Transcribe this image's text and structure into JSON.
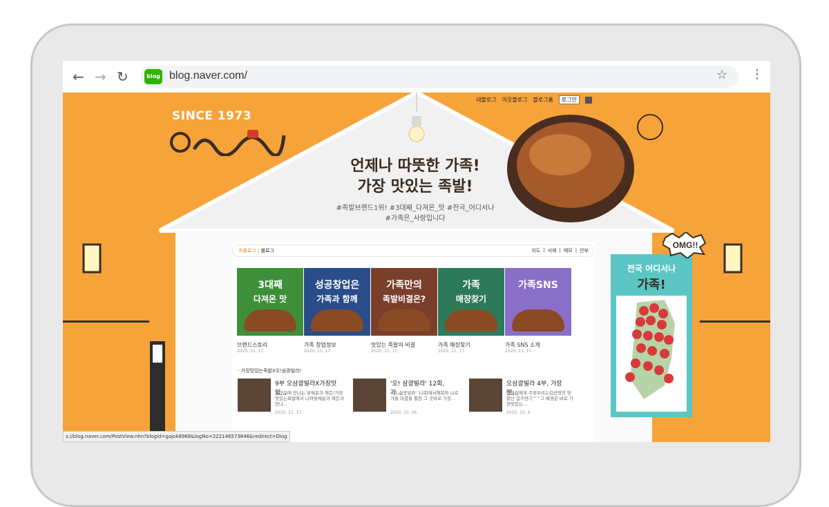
{
  "browser": {
    "url": "blog.naver.com/",
    "blog_icon_label": "blog",
    "back": "←",
    "forward": "→",
    "reload": "↻",
    "star": "☆",
    "menu": "⋮"
  },
  "topmenu": {
    "item1": "내블로그",
    "item2": "이웃블로그",
    "item3": "블로그홈",
    "login": "로그인"
  },
  "hero": {
    "since": "SINCE 1973",
    "headline1": "언제나 따뜻한 가족!",
    "headline2": "가장 맛있는 족발!",
    "tags1": "#족발브랜드1위! #3대째_다져온_맛 #전국_어디서나",
    "tags2": "#가족은_사랑입니다"
  },
  "blogbar": {
    "left1": "프롤로그",
    "left2": "블로그",
    "r1": "지도",
    "r2": "서재",
    "r3": "메모",
    "r4": "안부"
  },
  "thumbs": [
    {
      "banner_top": "3대째",
      "banner_bottom": "다져온 맛",
      "title": "브랜드스토리",
      "date": "2020. 11. 17.",
      "color": "#3e8f3a"
    },
    {
      "banner_top": "성공창업은",
      "banner_bottom": "가족과 함께",
      "title": "가족 창업정보",
      "date": "2020. 11. 17.",
      "color": "#2a4d8a"
    },
    {
      "banner_top": "가족만의",
      "banner_bottom": "족발비결은?",
      "title": "맛있는 족발의 비결",
      "date": "2020. 11. 17.",
      "color": "#7a3f2a"
    },
    {
      "banner_top": "가족",
      "banner_bottom": "매장찾기",
      "title": "가족 매장찾기",
      "date": "2020. 11. 17.",
      "color": "#2d7a5a"
    },
    {
      "banner_top": "가족SNS",
      "banner_bottom": "",
      "title": "가족 SNS 소개",
      "date": "2020. 11. 17.",
      "color": "#8a6fc8"
    }
  ],
  "section_label": "- 가장맛있는족발X오!삼광빌라!",
  "posts": [
    {
      "title": "9부 오삼광빌라X가장맛 있...",
      "excerpt": "최근길에 만나는 빛채운과 해든!가장맛있는족발에서 나와빛채운과 해든과 만나...",
      "date": "2020. 11. 17."
    },
    {
      "title": "'오! 삼광빌라' 12회, 가...",
      "excerpt": "'오! 삼광빌라' 12회에서해회와 나로가을 대결을 펼친 그 곳바로 가장...",
      "date": "2020. 10. 26."
    },
    {
      "title": "오삼광빌라 4부, 가장맛...",
      "excerpt": "인금진에게 주정부리는김선영의 맛 잘난 음주연기^^그 배경은 바로 가장맛있는...",
      "date": "2020. 10. 4."
    }
  ],
  "map": {
    "title": "전국 어디서나",
    "family": "가족!",
    "omg": "OMG!!"
  },
  "status_url": "s://blog.naver.com/PostView.nhn?blogId=gajok8968&logNo=222146573846&redirect=Dlog"
}
